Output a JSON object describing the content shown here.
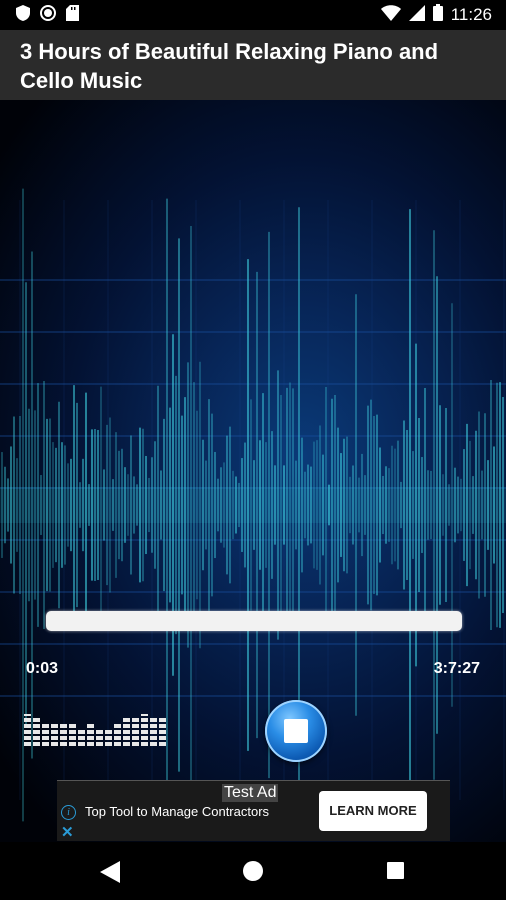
{
  "status_bar": {
    "time": "11:26",
    "left_icons": [
      "shield-icon",
      "record-icon",
      "sd-card-icon"
    ],
    "right_icons": [
      "wifi-icon",
      "signal-icon",
      "battery-icon"
    ]
  },
  "title": "3 Hours of Beautiful Relaxing Piano and Cello Music",
  "player": {
    "elapsed": "0:03",
    "duration": "3:7:27",
    "progress_fraction": 0.0003,
    "stop_icon": "stop-icon",
    "equalizer_icon": "equalizer-icon"
  },
  "ad": {
    "label": "Test Ad",
    "text": "Top Tool to Manage Contractors",
    "button": "LEARN MORE",
    "info_icon": "ad-info-icon",
    "close_icon": "ad-close-icon"
  },
  "nav": {
    "back_icon": "back-icon",
    "home_icon": "home-icon",
    "recents_icon": "recents-icon"
  },
  "colors": {
    "accent_wave": "#3fd0e0",
    "background_blue": "#072557",
    "title_bar": "#2b2b2b"
  }
}
